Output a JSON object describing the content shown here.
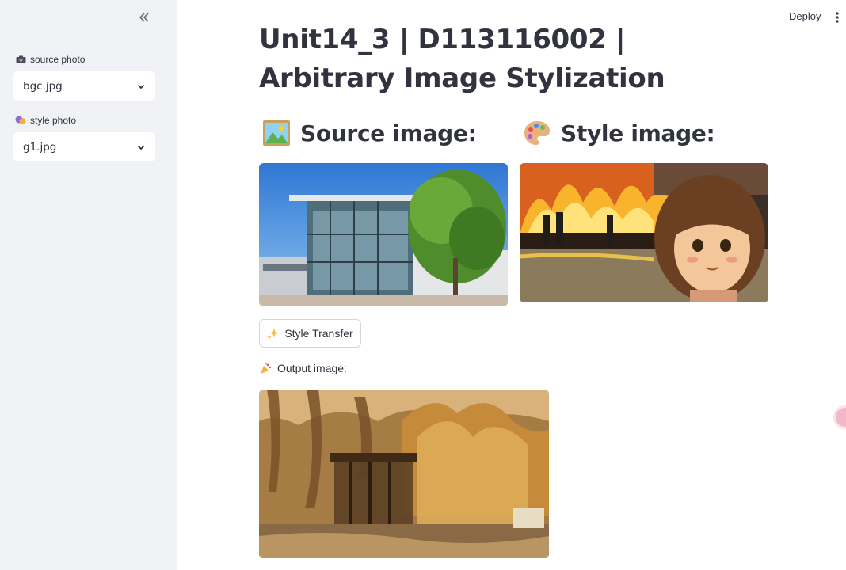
{
  "sidebar": {
    "collapse_icon": "double-chevron-left-icon",
    "source": {
      "label": "source photo",
      "icon": "camera-icon",
      "value": "bgc.jpg"
    },
    "style": {
      "label": "style photo",
      "icon": "masks-icon",
      "value": "g1.jpg"
    }
  },
  "header": {
    "deploy_label": "Deploy",
    "menu_icon": "kebab-menu-icon"
  },
  "main": {
    "title": "Unit14_3 | D113116002 | Arbitrary Image Stylization",
    "source_heading": "Source image:",
    "style_heading": "Style image:",
    "button_label": "Style Transfer",
    "output_label": "Output image:"
  },
  "colors": {
    "sidebar_bg": "#f0f2f6",
    "text": "#31333f",
    "border": "#d6d7dd"
  }
}
